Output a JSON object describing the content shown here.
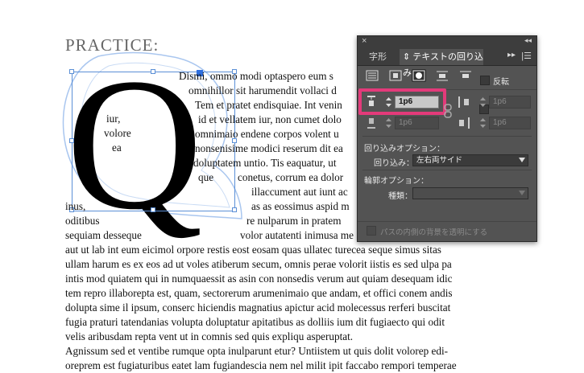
{
  "document": {
    "heading": "PRACTICE:",
    "drop_letter": "Q",
    "inner_text": [
      "iur,",
      "volore",
      "ea"
    ],
    "lines": [
      "Dismi, ommo modi optaspero eum s",
      "omnihillor sit harumendit vollaci d",
      "Tem et pratet endisquiae. Int venin",
      "id et vellatem iur, non cumet dolo",
      "omnimaio endene corpos volent u",
      "nonsenisime modici reserum dit ea",
      "doluptatem untio. Tis eaquatur, ut",
      "que",
      "conetus, corrum ea dolor",
      "illaccument aut iunt ac",
      "inus,",
      "as as eossimus aspid m",
      "oditibus",
      "re nulparum in pratem",
      "sequiam desseque",
      "volor autatenti inimusa me",
      "aut ut lab int eum eicimol orpore restis eost eosam quas ullatec turecea seque simus sitas",
      "ullam harum es ex eos ad ut voles atiberum secum, omnis perae volorit iistis es sed ulpa pa",
      "intis mod quiatem qui in numquaessit as asin con nonsedis verum aut quiam desequam idic",
      "tem repro illaborepta est, quam, sectorerum arumenimaio que andam, et offici conem andis",
      "dolupta sime il ipsum, conserc hiciendis magnatius apictur acid molecessus rerferi buscitat",
      "fugia praturi tatendanias volupta doluptatur apitatibus as dolliis ium dit fugiaecto qui odit",
      "velis aribusdam repta vent ut in comnis sed quis expliqu asperuptat.",
      "Agnissum sed et ventibe rumque opta inulparunt etur? Untiistem ut quis dolit volorep edi-",
      "oreprem est fugiaturibus eatet lam fugiandescia nem nel milit ipit faccabo rempori temperae"
    ]
  },
  "panel": {
    "tab_inactive": "字形",
    "tab_active": "テキストの回り込み",
    "invert_label": "反転",
    "offsets": {
      "top": "1p6",
      "left": "1p6",
      "bottom": "1p6",
      "right": "1p6"
    },
    "wrap_options_label": "回り込みオプション：",
    "wrap_to_label": "回り込み：",
    "wrap_to_value": "左右両サイド",
    "contour_options_label": "輪郭オプション：",
    "type_label": "種類：",
    "type_value": "",
    "include_inside_edges": "パスの内側の背景を透明にする",
    "colors": {
      "highlight": "#e33a7a",
      "panel_bg": "#535353"
    }
  }
}
